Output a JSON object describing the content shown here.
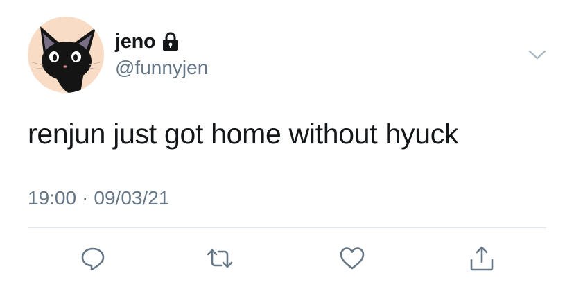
{
  "tweet": {
    "display_name": "jeno",
    "handle": "@funnyjen",
    "text": "renjun just got home without hyuck",
    "time": "19:00",
    "separator": "·",
    "date": "09/03/21"
  },
  "icons": {
    "avatar": "black-cat-avatar",
    "lock": "lock-icon",
    "menu": "chevron-down-icon",
    "reply": "reply-icon",
    "retweet": "retweet-icon",
    "like": "heart-icon",
    "share": "share-icon"
  },
  "colors": {
    "text_primary": "#14171a",
    "text_secondary": "#657786",
    "icon": "#657786",
    "avatar_bg": "#f9dcc6",
    "divider": "#e1e8ed"
  }
}
